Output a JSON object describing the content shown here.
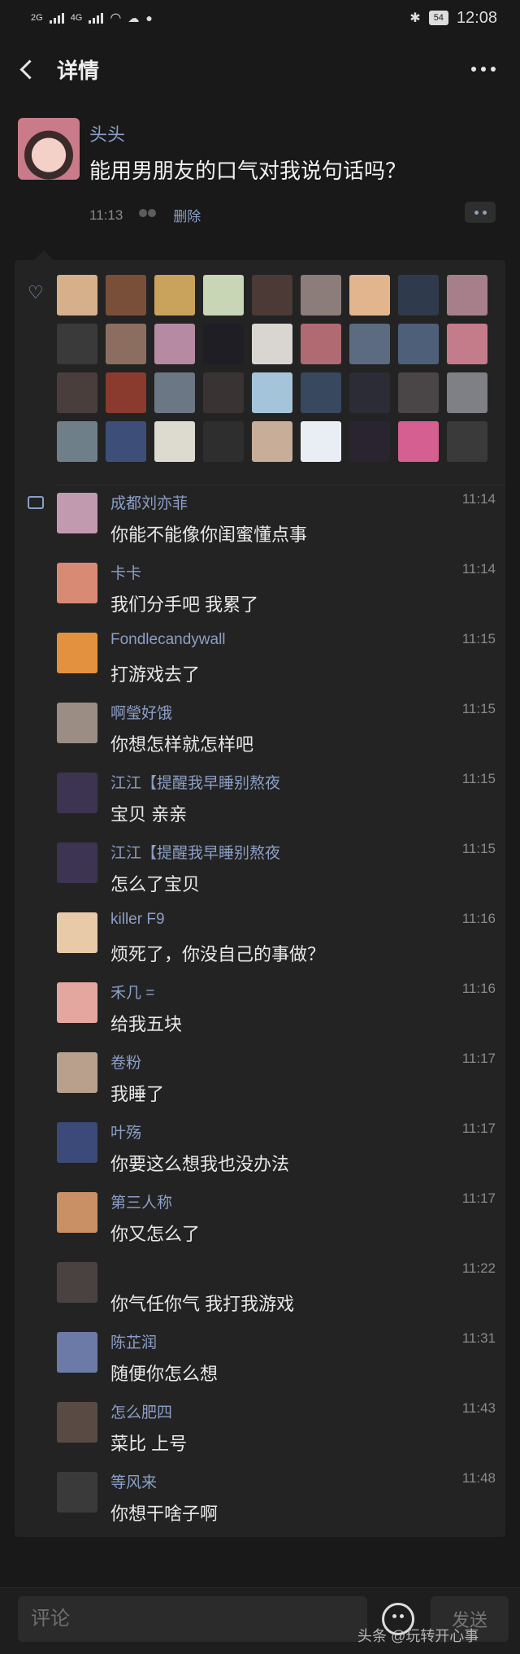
{
  "status_bar": {
    "time": "12:08",
    "battery": "54",
    "network_1": "2G",
    "network_2": "4G"
  },
  "header": {
    "title": "详情"
  },
  "post": {
    "author": "头头",
    "text": "能用男朋友的口气对我说句话吗？",
    "time": "11:13",
    "delete_label": "删除"
  },
  "likes": {
    "avatar_colors": [
      "#d6b08a",
      "#7a4f3a",
      "#c9a35c",
      "#c8d6b6",
      "#4b3a35",
      "#8d7d7a",
      "#e3b58f",
      "#2f3a4c",
      "#a77f8b",
      "#3a3a3a",
      "#8c6e60",
      "#b68aa3",
      "#1e1e24",
      "#d9d6d2",
      "#b06a71",
      "#5d6b80",
      "#4e5f7a",
      "#c47c8a",
      "#4a3e3c",
      "#8a3b2e",
      "#6c7786",
      "#3a3333",
      "#a4c4d9",
      "#37485f",
      "#2b2c36",
      "#4a4648",
      "#7f7f86",
      "#6f7f8a",
      "#3d4f78",
      "#dddad0",
      "#2e2e2e",
      "#c8ad98",
      "#e8eef4",
      "#2a2431",
      "#d45f90",
      "#3a3a3a"
    ]
  },
  "comments": [
    {
      "name": "成都刘亦菲",
      "time": "11:14",
      "text": "你能不能像你闺蜜懂点事",
      "avatar_color": "#c29ab0"
    },
    {
      "name": "卡卡",
      "time": "11:14",
      "text": "我们分手吧 我累了",
      "avatar_color": "#d98a74"
    },
    {
      "name": "Fondlecandywall",
      "time": "11:15",
      "text": "打游戏去了",
      "avatar_color": "#e3913f"
    },
    {
      "name": "啊瑩好饿",
      "time": "11:15",
      "text": "你想怎样就怎样吧",
      "avatar_color": "#9b8d83"
    },
    {
      "name": "江江【提醒我早睡别熬夜",
      "time": "11:15",
      "text": "宝贝 亲亲",
      "avatar_color": "#3c3450"
    },
    {
      "name": "江江【提醒我早睡别熬夜",
      "time": "11:15",
      "text": "怎么了宝贝",
      "avatar_color": "#3c3450"
    },
    {
      "name": "killer F9",
      "time": "11:16",
      "text": "烦死了，你没自己的事做？",
      "avatar_color": "#e8c9a8"
    },
    {
      "name": "禾几 =",
      "time": "11:16",
      "text": "给我五块",
      "avatar_color": "#e3a7a0"
    },
    {
      "name": "卷粉",
      "time": "11:17",
      "text": "我睡了",
      "avatar_color": "#b8a08c"
    },
    {
      "name": "叶殇",
      "time": "11:17",
      "text": "你要这么想我也没办法",
      "avatar_color": "#3b4a78"
    },
    {
      "name": "第三人称",
      "time": "11:17",
      "text": "你又怎么了",
      "avatar_color": "#c99066"
    },
    {
      "name": "",
      "time": "11:22",
      "text": "你气任你气 我打我游戏",
      "avatar_color": "#4a4240"
    },
    {
      "name": "陈芷润",
      "time": "11:31",
      "text": "随便你怎么想",
      "avatar_color": "#6c7aa8"
    },
    {
      "name": "怎么肥四",
      "time": "11:43",
      "text": "菜比 上号",
      "avatar_color": "#5a4a44"
    },
    {
      "name": "等风来",
      "time": "11:48",
      "text": "你想干啥子啊",
      "avatar_color": "#3a3a3a"
    }
  ],
  "bottom_bar": {
    "comment_placeholder": "评论",
    "send_label": "发送"
  },
  "watermark": "头条 @玩转开心事"
}
